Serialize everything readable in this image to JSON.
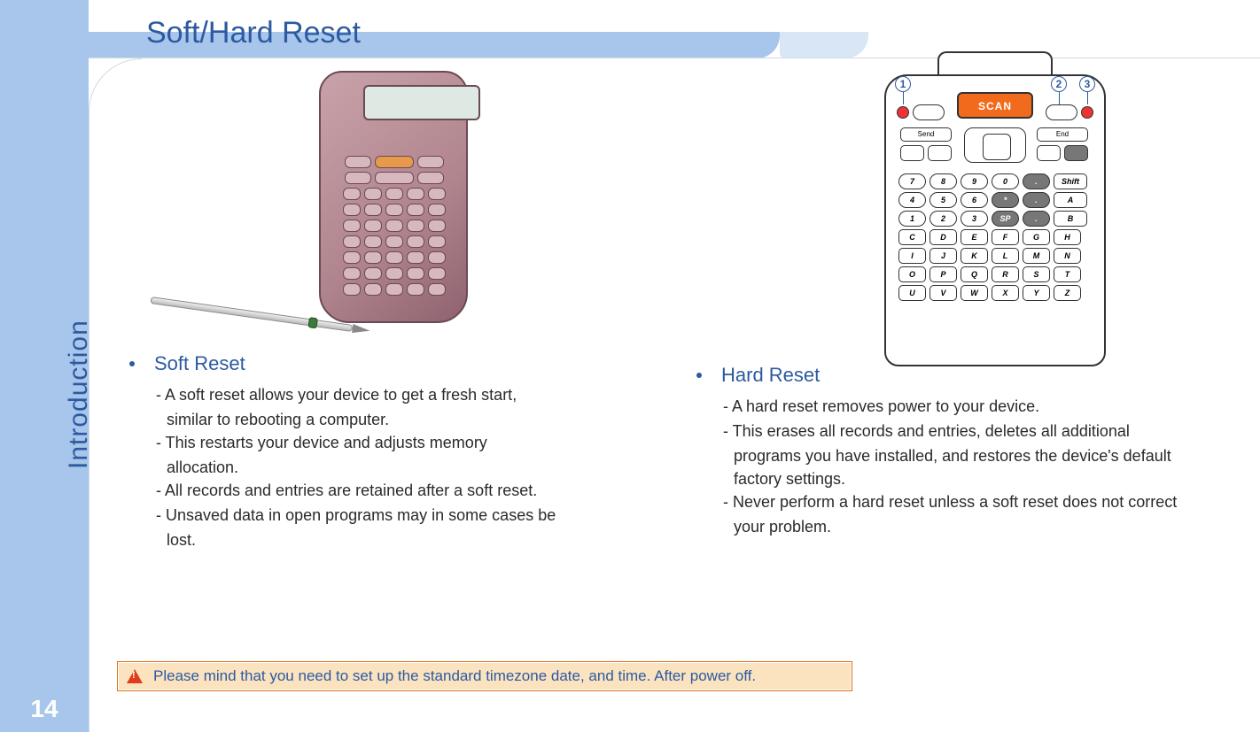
{
  "page_number": "14",
  "sidebar_label": "Introduction",
  "title": "Soft/Hard Reset",
  "device_right": {
    "scan_label": "SCAN"
  },
  "callouts": {
    "c1": "1",
    "c2": "2",
    "c3": "3"
  },
  "keypad": {
    "row1": [
      "7",
      "8",
      "9",
      "0",
      ".",
      "Shift"
    ],
    "row2": [
      "4",
      "5",
      "6",
      "*",
      ".",
      "A"
    ],
    "row3": [
      "1",
      "2",
      "3",
      "SP",
      ".",
      "B"
    ],
    "row4": [
      "C",
      "D",
      "E",
      "F",
      "G",
      "H"
    ],
    "row5": [
      "I",
      "J",
      "K",
      "L",
      "M",
      "N"
    ],
    "row6": [
      "O",
      "P",
      "Q",
      "R",
      "S",
      "T"
    ],
    "row7": [
      "U",
      "V",
      "W",
      "X",
      "Y",
      "Z"
    ]
  },
  "left": {
    "heading": "Soft Reset",
    "items": [
      "- A soft reset allows your device to get a fresh start,",
      "similar to rebooting a computer.",
      "- This restarts your device and adjusts memory",
      "allocation.",
      "- All records and entries are retained after a soft reset.",
      "- Unsaved data in open programs may in some cases be",
      "lost."
    ]
  },
  "right": {
    "heading": "Hard Reset",
    "items": [
      "- A hard reset removes power to your device.",
      "- This erases all records and entries, deletes all additional",
      "programs you have installed, and restores the device's default",
      "factory settings.",
      "- Never perform a hard reset unless a soft reset does not correct",
      "your problem."
    ]
  },
  "warning": "Please mind that you need to set up the standard timezone date, and time. After power off."
}
